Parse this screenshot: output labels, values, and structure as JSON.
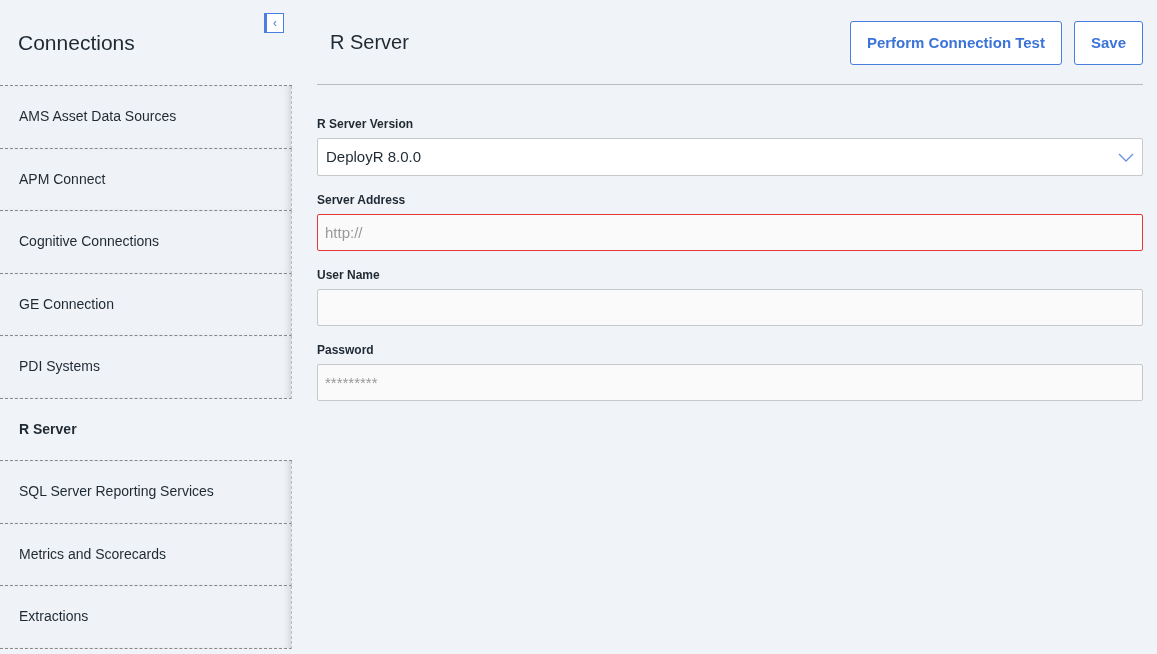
{
  "sidebar": {
    "title": "Connections",
    "collapse_button": "‹",
    "items": [
      {
        "label": "AMS Asset Data Sources",
        "selected": false
      },
      {
        "label": "APM Connect",
        "selected": false
      },
      {
        "label": "Cognitive Connections",
        "selected": false
      },
      {
        "label": "GE Connection",
        "selected": false
      },
      {
        "label": "PDI Systems",
        "selected": false
      },
      {
        "label": "R Server",
        "selected": true
      },
      {
        "label": "SQL Server Reporting Services",
        "selected": false
      },
      {
        "label": "Metrics and Scorecards",
        "selected": false
      },
      {
        "label": "Extractions",
        "selected": false
      }
    ]
  },
  "main": {
    "title": "R Server",
    "buttons": [
      "Perform Connection Test",
      "Save"
    ],
    "fields": [
      {
        "kind": "select",
        "label": "R Server Version",
        "value": "DeployR 8.0.0",
        "invalid": false
      },
      {
        "kind": "text",
        "label": "Server Address",
        "placeholder": "http://",
        "invalid": true
      },
      {
        "kind": "text",
        "label": "User Name",
        "invalid": false
      },
      {
        "kind": "text",
        "label": "Password",
        "placeholder": "*********",
        "invalid": false
      }
    ]
  }
}
